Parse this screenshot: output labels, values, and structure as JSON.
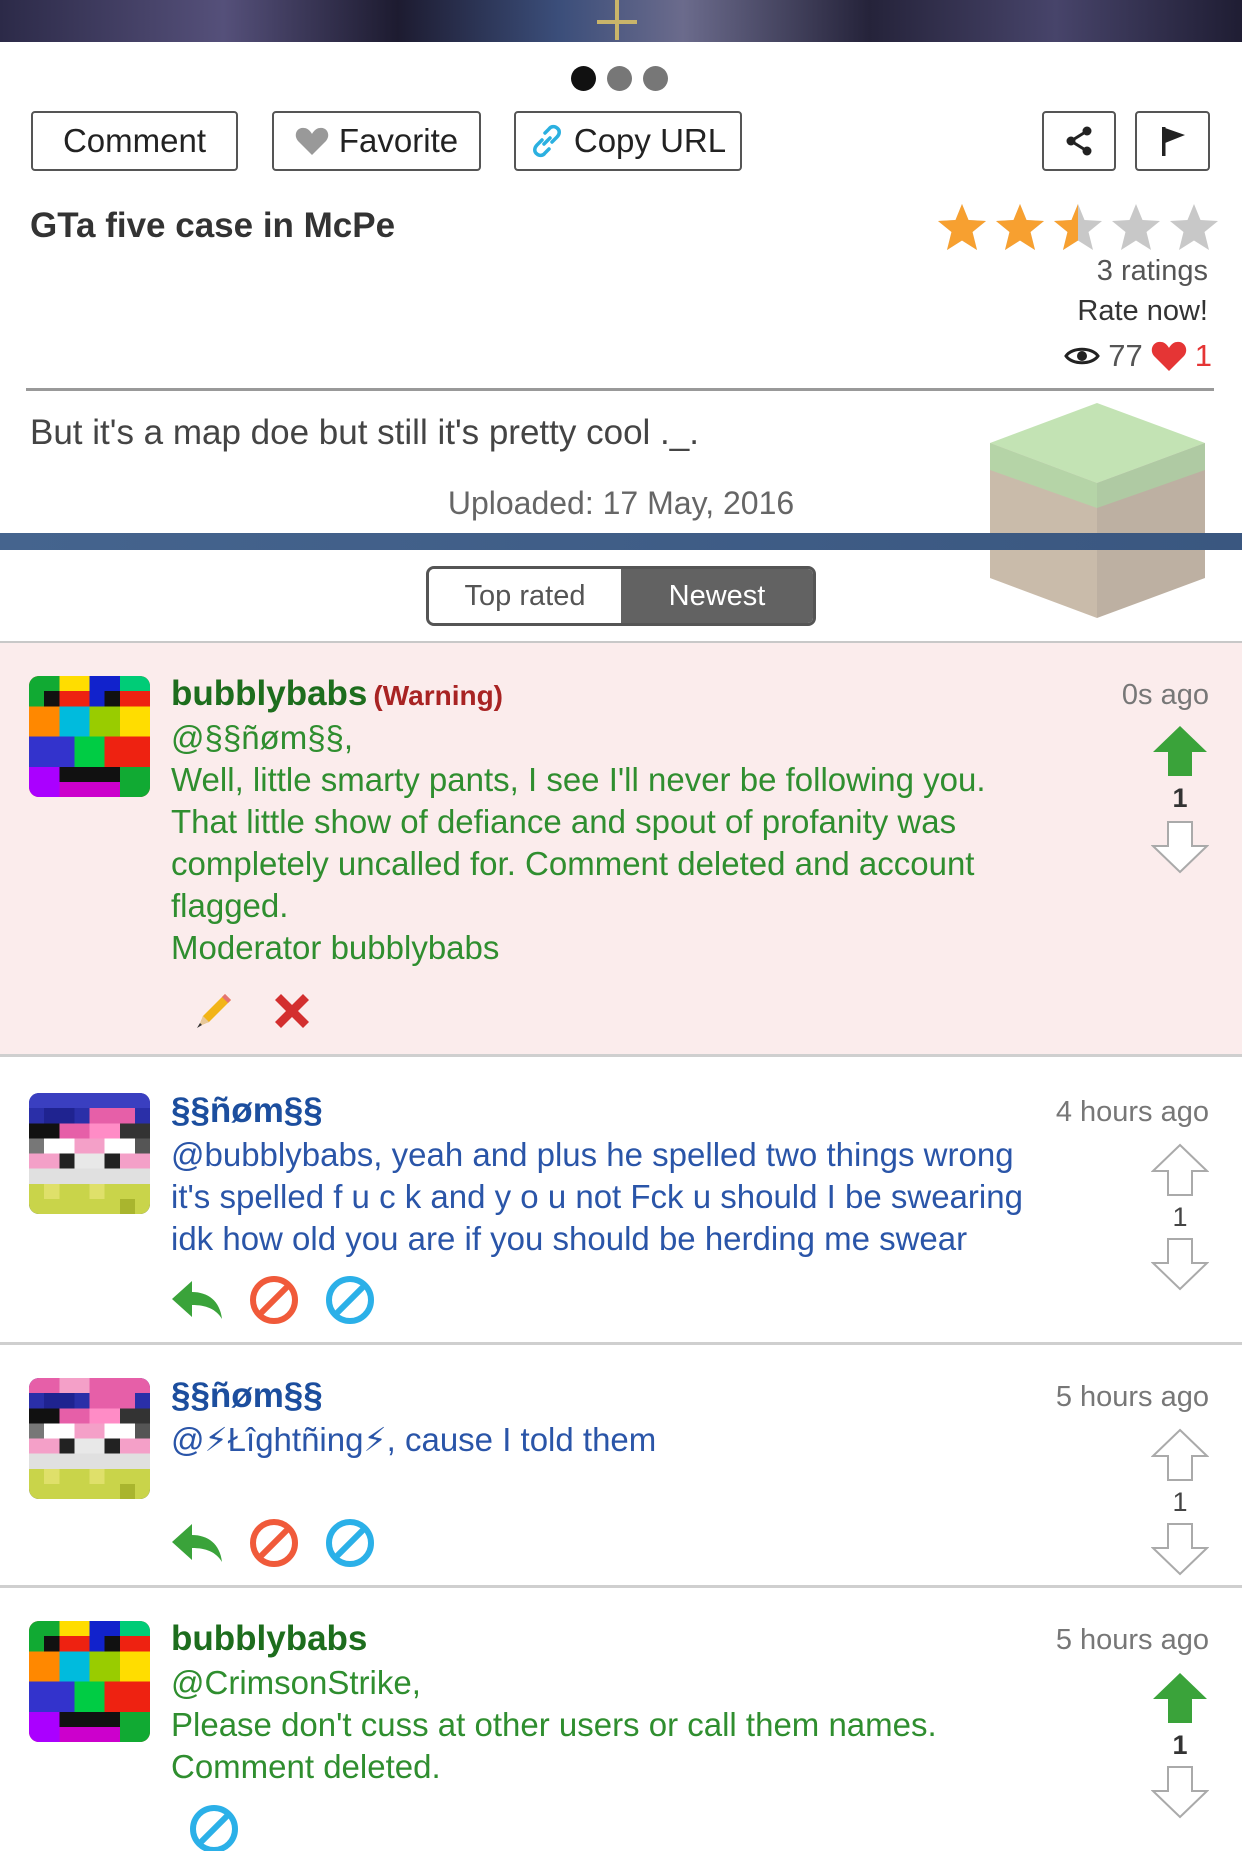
{
  "toolbar": {
    "comment_label": "Comment",
    "favorite_label": "Favorite",
    "copy_url_label": "Copy URL"
  },
  "carousel": {
    "page_count": 3,
    "active_index": 0
  },
  "post": {
    "title": "GTa five case in McPe",
    "rating": {
      "value": 2.5,
      "max": 5,
      "count_label": "3 ratings",
      "rate_label": "Rate now!"
    },
    "views": "77",
    "likes": "1",
    "description": "But it's a map doe but still it's pretty cool ._.",
    "uploaded": "Uploaded: 17 May, 2016"
  },
  "sort": {
    "top_rated": "Top rated",
    "newest": "Newest",
    "selected": "Newest"
  },
  "colors": {
    "accent_bar": "#45648e",
    "warning_bg": "#fbecec",
    "mod_green": "#2f8e2f",
    "user_blue": "#2a55a8",
    "vote_green": "#3aa33a"
  },
  "comments": [
    {
      "author": "bubblybabs",
      "badge": "(Warning)",
      "time": "0s ago",
      "lines": [
        "@§§ñøm§§,",
        "Well, little smarty pants, I see I'll never be following you.",
        "That little show of defiance and spout of profanity was",
        "completely uncalled for. Comment deleted and account",
        "flagged.",
        "Moderator bubblybabs"
      ],
      "votes": "1",
      "upvoted": true,
      "actions": [
        "edit-icon",
        "delete-icon"
      ]
    },
    {
      "author": "§§ñøm§§",
      "time": "4 hours ago",
      "lines": [
        "@bubblybabs, yeah and plus he spelled two things wrong",
        "it's spelled f u c k and y o u not Fck u should I be swearing",
        "idk how old you are if you should be herding me swear"
      ],
      "votes": "1",
      "upvoted": false,
      "actions": [
        "reply-icon",
        "report-icon",
        "block-icon"
      ]
    },
    {
      "author": "§§ñøm§§",
      "time": "5 hours ago",
      "lines": [
        "@⚡Łîghtñing⚡, cause I told them"
      ],
      "votes": "1",
      "upvoted": false,
      "actions": [
        "reply-icon",
        "report-icon",
        "block-icon"
      ]
    },
    {
      "author": "bubblybabs",
      "time": "5 hours ago",
      "lines": [
        "@CrimsonStrike,",
        "Please don't cuss at other users or call them names.",
        "Comment deleted."
      ],
      "votes": "1",
      "upvoted": true,
      "actions": [
        "block-icon"
      ]
    }
  ]
}
